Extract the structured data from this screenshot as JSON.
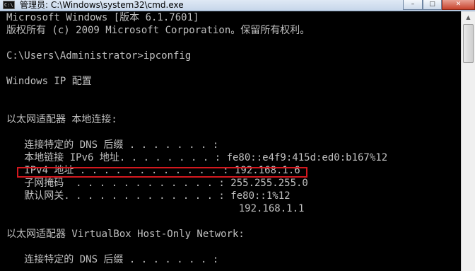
{
  "window": {
    "title": "管理员: C:\\Windows\\system32\\cmd.exe",
    "icon_label": "C:\\",
    "controls": {
      "minimize": "–",
      "maximize": "□",
      "close": "✕"
    }
  },
  "console": {
    "lines": [
      "Microsoft Windows [版本 6.1.7601]",
      "版权所有 (c) 2009 Microsoft Corporation。保留所有权利。",
      "",
      "C:\\Users\\Administrator>ipconfig",
      "",
      "Windows IP 配置",
      "",
      "",
      "以太网适配器 本地连接:",
      "",
      "   连接特定的 DNS 后缀 . . . . . . . :",
      "   本地链接 IPv6 地址. . . . . . . . : fe80::e4f9:415d:ed0:b167%12",
      "   IPv4 地址 . . . . . . . . . . . . : 192.168.1.6",
      "   子网掩码  . . . . . . . . . . . . : 255.255.255.0",
      "   默认网关. . . . . . . . . . . . . : fe80::1%12",
      "                                       192.168.1.1",
      "",
      "以太网适配器 VirtualBox Host-Only Network:",
      "",
      "   连接特定的 DNS 后缀 . . . . . . . :"
    ]
  },
  "annotation": {
    "highlight_color": "#d4181e",
    "target_line_index": 12
  },
  "scrollbar": {
    "up_arrow": "▲"
  }
}
